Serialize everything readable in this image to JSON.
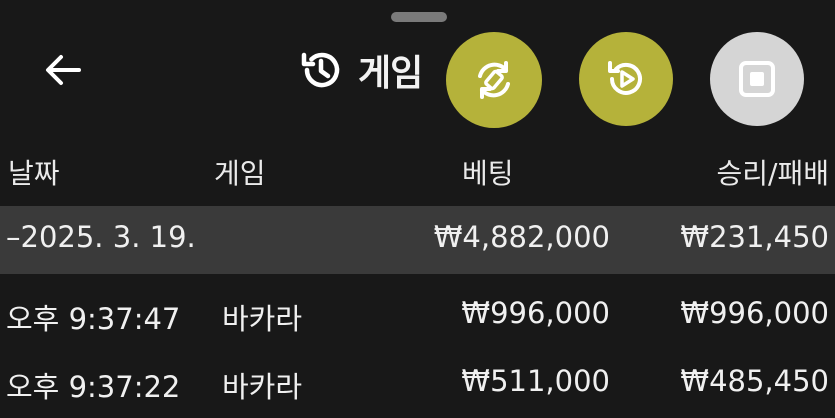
{
  "header": {
    "title": "게임",
    "icons": {
      "back": "arrow-left-icon",
      "history": "history-icon",
      "replay": "replay-icon",
      "play": "play-circle-icon",
      "stop": "stop-icon"
    }
  },
  "table": {
    "columns": [
      "날짜",
      "게임",
      "베팅",
      "승리/패배"
    ],
    "summary": {
      "date": "–2025. 3. 19.",
      "bet": "₩4,882,000",
      "result": "₩231,450"
    },
    "rows": [
      {
        "time": "오후 9:37:47",
        "game": "바카라",
        "bet": "₩996,000",
        "result": "₩996,000"
      },
      {
        "time": "오후 9:37:22",
        "game": "바카라",
        "bet": "₩511,000",
        "result": "₩485,450"
      }
    ]
  },
  "colors": {
    "background": "#181818",
    "summary_row": "#3a3a3a",
    "fab_active": "#b5b23a",
    "fab_stop": "#d5d5d5"
  }
}
